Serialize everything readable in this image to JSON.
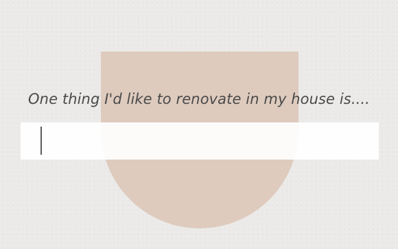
{
  "prompt": {
    "text": "One thing I'd like to renovate in my house is...."
  },
  "answer": {
    "value": "",
    "placeholder": ""
  },
  "colors": {
    "background": "#ebeae8",
    "arch": "#decbbe",
    "input_background": "#fbfbfb",
    "text": "#4a4a4a"
  }
}
